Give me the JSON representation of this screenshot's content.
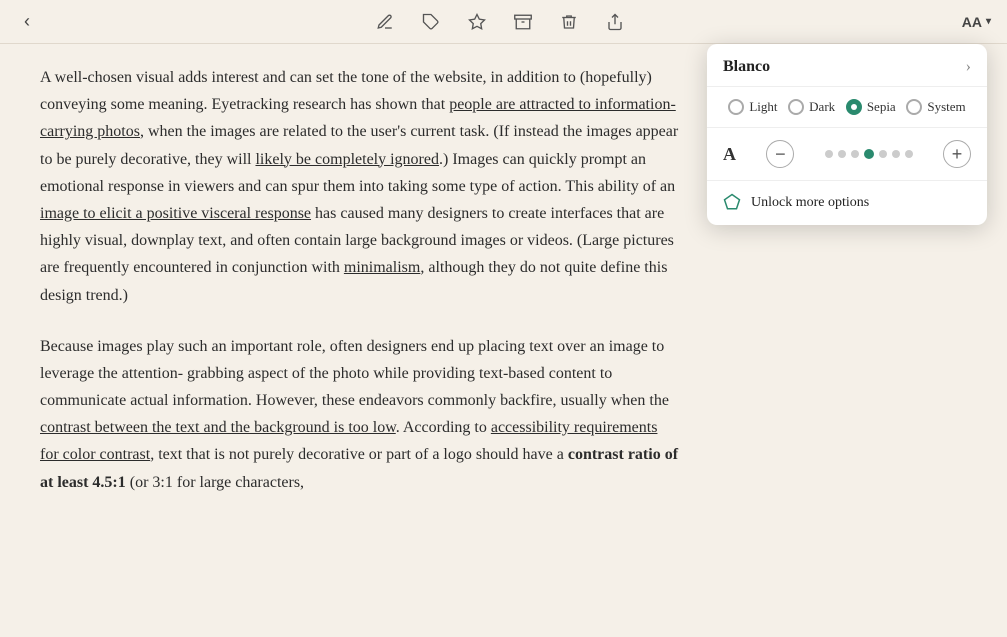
{
  "toolbar": {
    "back_label": "‹",
    "aa_label": "AA",
    "chevron_down": "˅",
    "icons": {
      "pen": "✏",
      "tag": "⌗",
      "star": "☆",
      "inbox": "⬡",
      "trash": "🗑",
      "share": "⬆"
    }
  },
  "popup": {
    "title": "Blanco",
    "chevron": "›",
    "themes": [
      {
        "id": "light",
        "label": "Light",
        "selected": false
      },
      {
        "id": "dark",
        "label": "Dark",
        "selected": false
      },
      {
        "id": "sepia",
        "label": "Sepia",
        "selected": true
      },
      {
        "id": "system",
        "label": "System",
        "selected": false
      }
    ],
    "font_letter": "A",
    "minus_label": "−",
    "plus_label": "+",
    "unlock_label": "Unlock more options"
  },
  "content": {
    "paragraph1": "A well-chosen visual adds interest and can set the tone of the website, in addition to (hopefully) conveying some meaning. Eyetracking research has shown that people are attracted to information-carrying photos, when the images are related to the user's current task. (If instead the images appear to be purely decorative, they will likely be completely ignored.) Images can quickly prompt an emotional response in viewers and can spur them into taking some type of action. This ability of an image to elicit a positive visceral response has caused many designers to create interfaces that are highly visual, downplay text, and often contain large background images or videos. (Large pictures are frequently encountered in conjunction with minimalism, although they do not quite define this design trend.)",
    "paragraph2": "Because images play such an important role, often designers end up placing text over an image to leverage the attention-grabbing aspect of the photo while providing text-based content to communicate actual information. However, these endeavors commonly backfire, usually when the contrast between the text and the background is too low. According to accessibility requirements for color contrast, text that is not purely decorative or part of a logo should have a contrast ratio of at least 4.5:1 (or 3:1 for large characters,"
  }
}
